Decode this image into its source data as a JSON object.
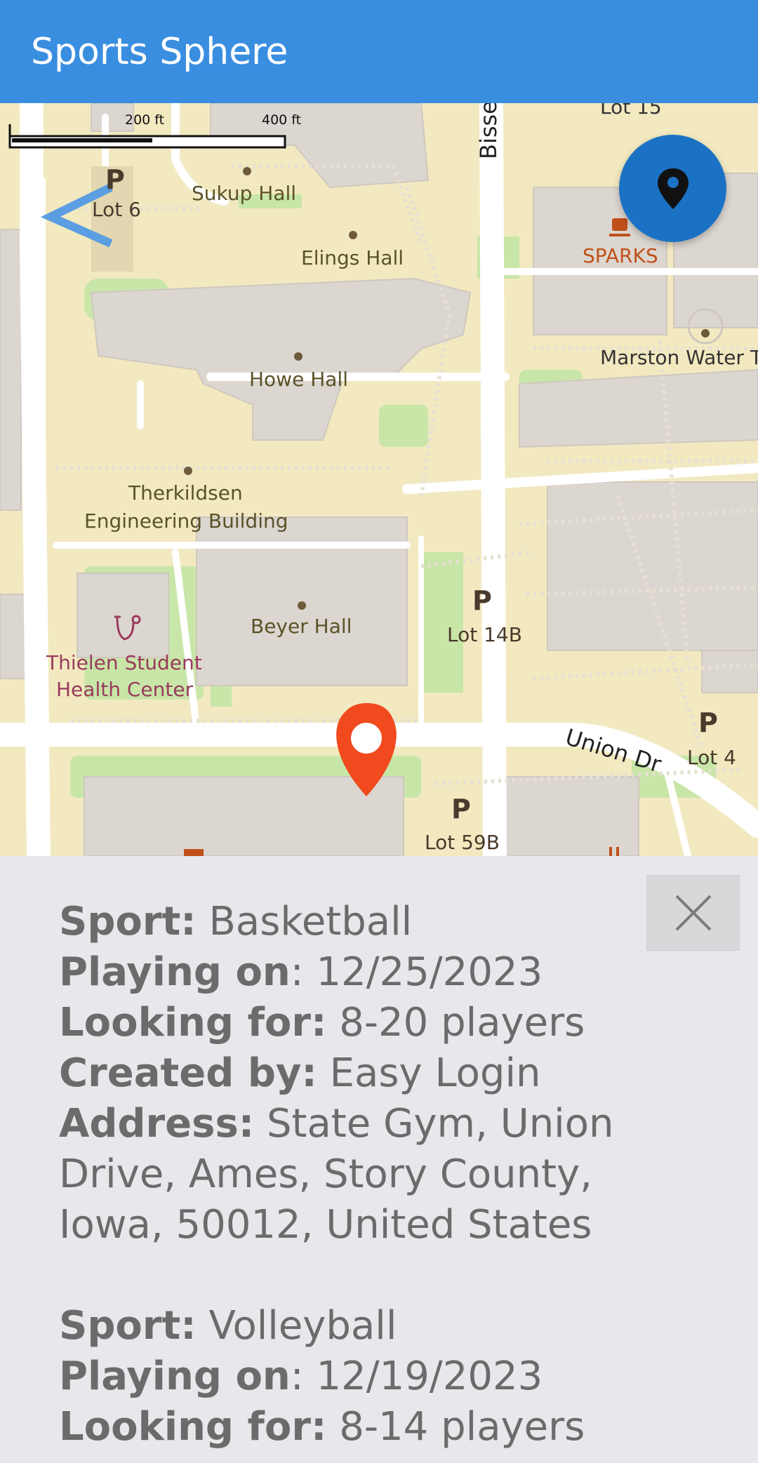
{
  "app": {
    "title": "Sports Sphere"
  },
  "map": {
    "scale": {
      "label_short": "200 ft",
      "label_long": "400 ft"
    },
    "labels": {
      "sukup": "Sukup Hall",
      "elings": "Elings Hall",
      "howe": "Howe Hall",
      "therkildsen_1": "Therkildsen",
      "therkildsen_2": "Engineering Building",
      "beyer": "Beyer Hall",
      "thielen_1": "Thielen Student",
      "thielen_2": "Health Center",
      "sparks": "SPARKS",
      "marston": "Marston Water T",
      "lot6": "Lot 6",
      "lot14b": "Lot 14B",
      "lot4": "Lot 4",
      "lot59b": "Lot 59B",
      "lot15": "Lot 15",
      "union_dr": "Union Dr",
      "bissell": "Bisse",
      "parking_glyph": "P"
    },
    "icons": [
      "back-chevron-icon",
      "location-pin-icon",
      "map-marker-icon",
      "close-icon"
    ],
    "colors": {
      "fab": "#1b72c4",
      "marker": "#f04a1e",
      "appbar": "#3a8ee0"
    }
  },
  "panel": {
    "events": [
      {
        "sport_label": "Sport:",
        "sport": "Basketball",
        "date_label": "Playing on",
        "date": "12/25/2023",
        "looking_label": "Looking for:",
        "looking": "8-20 players",
        "created_label": "Created by:",
        "created": "Easy Login",
        "address_label": "Address:",
        "address": "State Gym, Union Drive, Ames, Story County, Iowa, 50012, United States"
      },
      {
        "sport_label": "Sport:",
        "sport": "Volleyball",
        "date_label": "Playing on",
        "date": "12/19/2023",
        "looking_label": "Looking for:",
        "looking": "8-14 players"
      }
    ]
  }
}
